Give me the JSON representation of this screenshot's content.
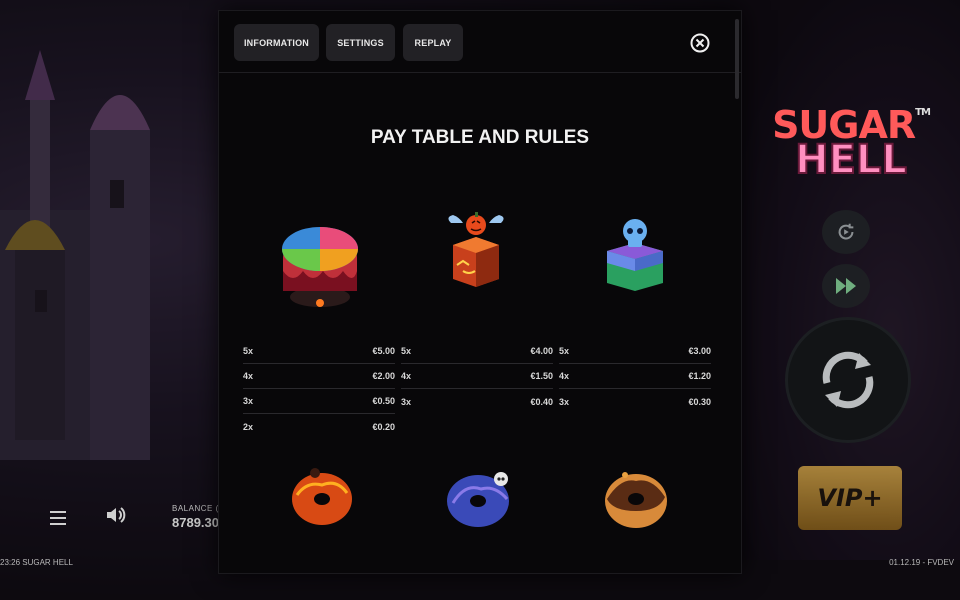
{
  "game": {
    "logo_line1": "SUGAR",
    "logo_line2": "HELL",
    "logo_tm": "TM",
    "balance_label": "BALANCE (",
    "balance_value": "8789.30",
    "footer_left": "23:26  SUGAR HELL",
    "footer_right": "01.12.19 - FVDEV",
    "vip_label": "VIP+"
  },
  "modal": {
    "tabs": [
      "INFORMATION",
      "SETTINGS",
      "REPLAY"
    ],
    "title": "PAY TABLE AND RULES"
  },
  "paytable": [
    {
      "symbol": "rainbow-cake-icon",
      "rows": [
        {
          "count": "5x",
          "payout": "€5.00"
        },
        {
          "count": "4x",
          "payout": "€2.00"
        },
        {
          "count": "3x",
          "payout": "€0.50"
        },
        {
          "count": "2x",
          "payout": "€0.20"
        }
      ]
    },
    {
      "symbol": "pumpkin-jelly-cube-icon",
      "rows": [
        {
          "count": "5x",
          "payout": "€4.00"
        },
        {
          "count": "4x",
          "payout": "€1.50"
        },
        {
          "count": "3x",
          "payout": "€0.40"
        }
      ]
    },
    {
      "symbol": "skull-jelly-cube-icon",
      "rows": [
        {
          "count": "5x",
          "payout": "€3.00"
        },
        {
          "count": "4x",
          "payout": "€1.20"
        },
        {
          "count": "3x",
          "payout": "€0.30"
        }
      ]
    }
  ],
  "lower_symbols": [
    "red-donut-icon",
    "blue-eyeball-donut-icon",
    "chocolate-donut-icon"
  ]
}
